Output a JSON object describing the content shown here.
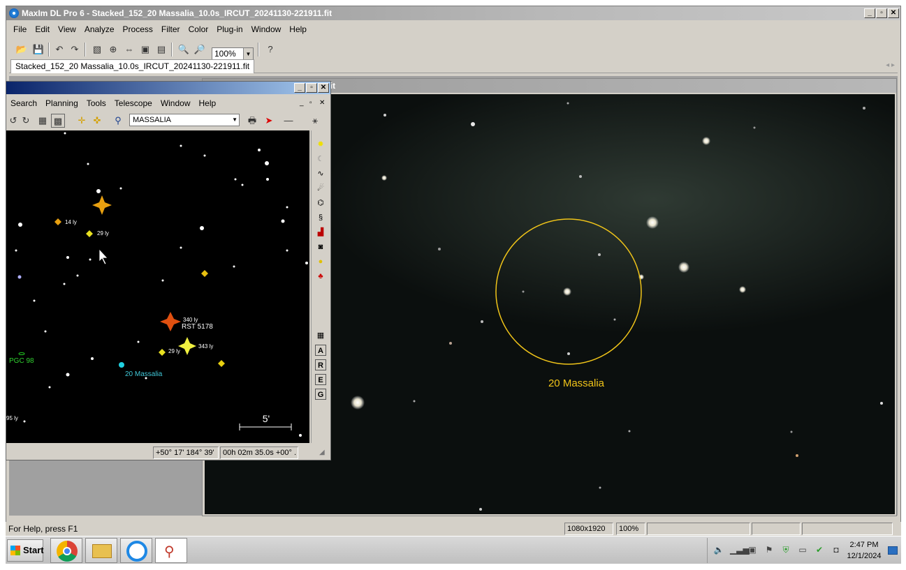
{
  "app": {
    "title": "MaxIm DL Pro 6 - Stacked_152_20  Massalia_10.0s_IRCUT_20241130-221911.fit",
    "caption_buttons": {
      "minimize": "_",
      "maximize": "▫",
      "close": "✕"
    }
  },
  "menu": [
    "File",
    "Edit",
    "View",
    "Analyze",
    "Process",
    "Filter",
    "Color",
    "Plug-in",
    "Window",
    "Help"
  ],
  "toolbar": {
    "zoom_value": "100%",
    "icons": [
      "open-icon",
      "save-icon",
      "undo-icon",
      "redo-icon",
      "screen-stretch-icon",
      "center-icon",
      "flip-icon",
      "crop-icon",
      "stack-icon",
      "zoom-in-icon",
      "zoom-out-icon",
      "context-help-icon"
    ]
  },
  "document_tab": {
    "label": "Stacked_152_20  Massalia_10.0s_IRCUT_20241130-221911.fit"
  },
  "image_window": {
    "title": "0.0s_IRCUT_20241130-221911.fit",
    "target_label": "20 Massalia",
    "circle_color": "#f0c419"
  },
  "planetarium": {
    "menu": [
      "Search",
      "Planning",
      "Tools",
      "Telescope",
      "Window",
      "Help"
    ],
    "target": "MASSALIA",
    "labels": {
      "star1_dist": "14 ly",
      "star2_dist": "29 ly",
      "rst_dist": "340 ly",
      "rst_name": "RST 5178",
      "star3_dist": "29 ly",
      "star4_dist": "343 ly",
      "galaxy": "PGC 98",
      "asteroid": "20 Massalia",
      "edge_dist": "95 ly",
      "scale": "5'"
    },
    "status": {
      "altaz": "+50° 17'  184° 39'",
      "radec": "00h 02m 35.0s  +00° ."
    }
  },
  "status_bar": {
    "help": "For Help, press F1",
    "dimensions": "1080x1920",
    "zoom": "100%"
  },
  "taskbar": {
    "start_label": "Start",
    "time": "2:47 PM",
    "date": "12/1/2024"
  }
}
